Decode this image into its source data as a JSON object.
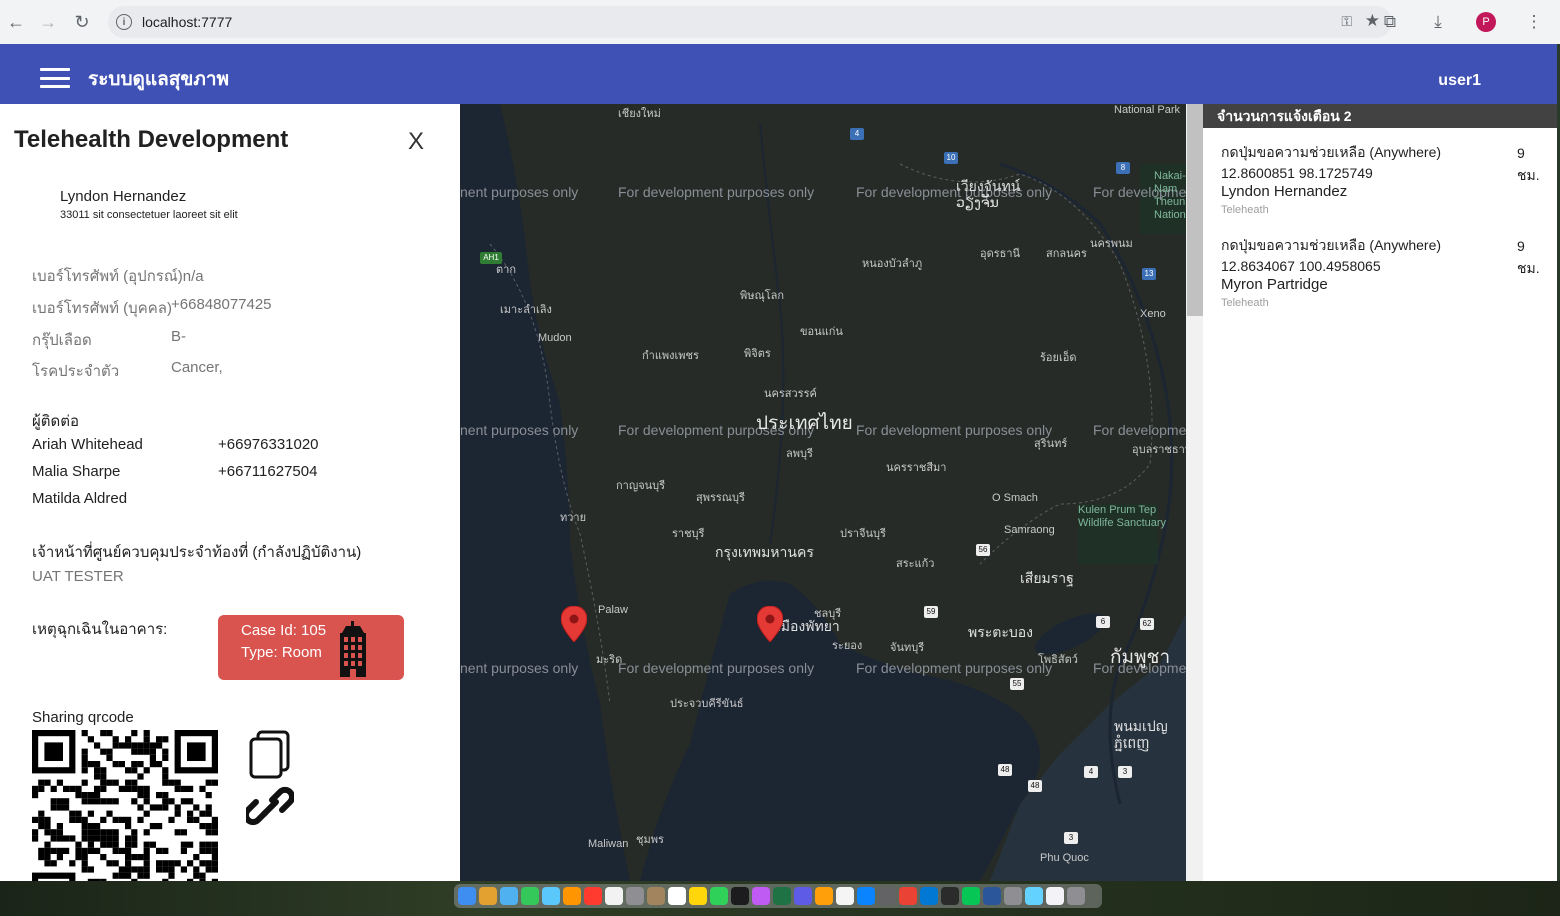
{
  "browser": {
    "url": "localhost:7777",
    "profile_initial": "P",
    "icons": [
      "back-icon",
      "forward-icon",
      "reload-icon",
      "info-icon",
      "key-icon",
      "star-icon",
      "extensions-icon",
      "download-icon",
      "menu-icon"
    ]
  },
  "appbar": {
    "title": "ระบบดูแลสุขภาพ",
    "user": "user1"
  },
  "left_panel": {
    "title": "Telehealth Development",
    "close_label": "X",
    "patient": {
      "name": "Lyndon Hernandez",
      "address": "33011 sit consectetuer laoreet sit elit"
    },
    "info": [
      {
        "label": "เบอร์โทรศัพท์ (อุปกรณ์)",
        "value": "n/a"
      },
      {
        "label": "เบอร์โทรศัพท์ (บุคคล)",
        "value": "+66848077425"
      },
      {
        "label": "กรุ๊ปเลือด",
        "value": "B-"
      },
      {
        "label": "โรคประจำตัว",
        "value": "Cancer,"
      }
    ],
    "contacts_heading": "ผู้ติดต่อ",
    "contacts": [
      {
        "name": "Ariah Whitehead",
        "phone": "+66976331020"
      },
      {
        "name": "Malia Sharpe",
        "phone": "+66711627504"
      },
      {
        "name": "Matilda Aldred",
        "phone": ""
      }
    ],
    "officer_heading": "เจ้าหน้าที่ศูนย์ควบคุมประจำท้องที่ (กำลังปฏิบัติงาน)",
    "officer_name": "UAT TESTER",
    "building_heading": "เหตุฉุกเฉินในอาคาร:",
    "case": {
      "id_line": "Case Id: 105",
      "type_line": "Type: Room"
    },
    "qr_heading": "Sharing qrcode"
  },
  "map": {
    "watermark": "For development purposes only",
    "watermark_partial_left": "nent purposes only",
    "watermark_partial_right": "For developme",
    "country_label": "ประเทศไทย",
    "bangkok_label": "กรุงเทพมหานคร",
    "cambodia_label": "กัมพูชา",
    "places": {
      "chiang_mai": "เชียงใหม่",
      "vientiane": "เวียงจันทน์",
      "vientiane_lao": "ວຽງຈັນ",
      "pattaya": "เมืองพัทยา",
      "mudon": "Mudon",
      "palaw": "Palaw",
      "maliwan": "Maliwan",
      "xeno": "Xeno",
      "phu_quoc": "Phu Quoc",
      "phnom_penh": "พนมเปญ",
      "phnom_penh_km": "ភ្នំពេញ",
      "o_smach": "O Smach",
      "samraong": "Samraong",
      "kulen": "Kulen Prum Tep Wildlife Sanctuary",
      "nakai": "Nakai-Nam Theun National",
      "national_park": "National Park",
      "mawlamyine": "เมาะลำเลิง",
      "nakhon_ratchasima": "นครราชสีมา",
      "khon_kaen": "ขอนแก่น",
      "phitsanulok": "พิษณุโลก",
      "nakhon_sawan": "นครสวรรค์",
      "chon_buri": "ชลบุรี",
      "rayong": "ระยอง",
      "chanthaburi": "จันทบุรี",
      "surin": "สุรินทร์",
      "udon_thani": "อุดรธานี",
      "sakon_nakhon": "สกลนคร",
      "nakhon_phanom": "นครพนม",
      "ubon": "อุบลราชธานี",
      "roi_et": "ร้อยเอ็ด",
      "kamphaeng_phet": "กำแพงเพชร",
      "phichit": "พิจิตร",
      "lopburi": "ลพบุรี",
      "suphanburi": "สุพรรณบุรี",
      "kanchanaburi": "กาญจนบุรี",
      "ratchaburi": "ราชบุรี",
      "prachinburi": "ปราจีนบุรี",
      "sa_kaeo": "สระแก้ว",
      "battambang": "พระตะบอง",
      "siem_reap": "เสียมราฐ",
      "pursat": "โพธิสัตว์",
      "chumphon": "ชุมพร",
      "hua_hin": "ประจวบคีรีขันธ์",
      "tavoy": "ทวาย",
      "mergui": "มะริด",
      "tak": "ตาก",
      "nong_khai": "หนองบัวลำภู"
    },
    "pin_color": "#e53935"
  },
  "right_panel": {
    "header": "จำนวนการแจ้งเตือน 2",
    "alerts": [
      {
        "message": "กดปุ่มขอความช่วยเหลือ (Anywhere) 12.8600851 98.1725749",
        "time": "9 ชม.",
        "name": "Lyndon Hernandez",
        "source": "Teleheath"
      },
      {
        "message": "กดปุ่มขอความช่วยเหลือ (Anywhere) 12.8634067 100.4958065",
        "time": "9 ชม.",
        "name": "Myron Partridge",
        "source": "Teleheath"
      }
    ]
  },
  "colors": {
    "appbar": "#3f51b5",
    "case_card": "#d9534f",
    "alert_header": "#424242",
    "map_bg": "#1f2733"
  }
}
